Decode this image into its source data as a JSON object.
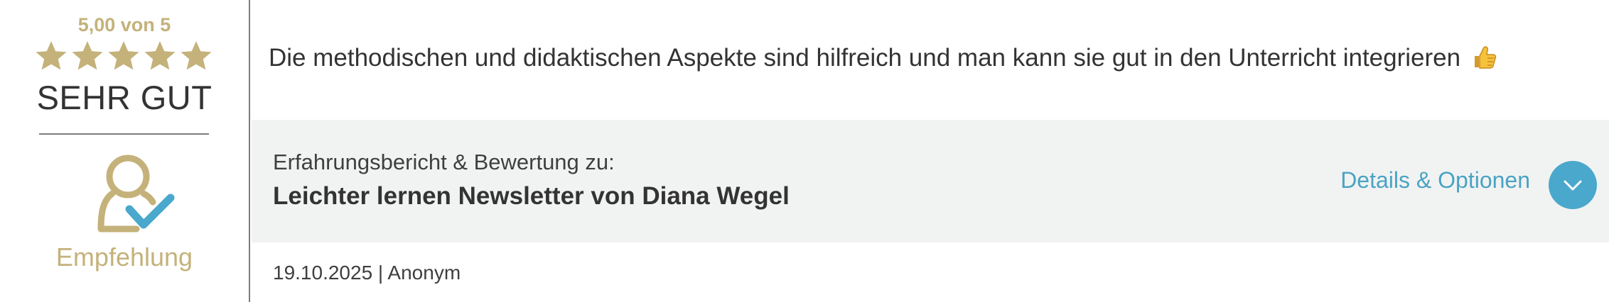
{
  "rating": {
    "score_text": "5,00 von 5",
    "stars": 5,
    "max_stars": 5,
    "verdict": "SEHR GUT",
    "recommendation": "Empfehlung",
    "star_color": "#c4b27a"
  },
  "review": {
    "text": "Die methodischen und didaktischen Aspekte sind hilfreich und man kann sie gut in den Unterricht integrieren",
    "emoji_icon": "thumbs-up-icon"
  },
  "panel": {
    "label": "Erfahrungsbericht & Bewertung zu:",
    "title": "Leichter lernen Newsletter von Diana Wegel",
    "details_label": "Details & Optionen",
    "accent_color": "#4aa8cc"
  },
  "meta": {
    "text": "19.10.2025 | Anonym"
  }
}
